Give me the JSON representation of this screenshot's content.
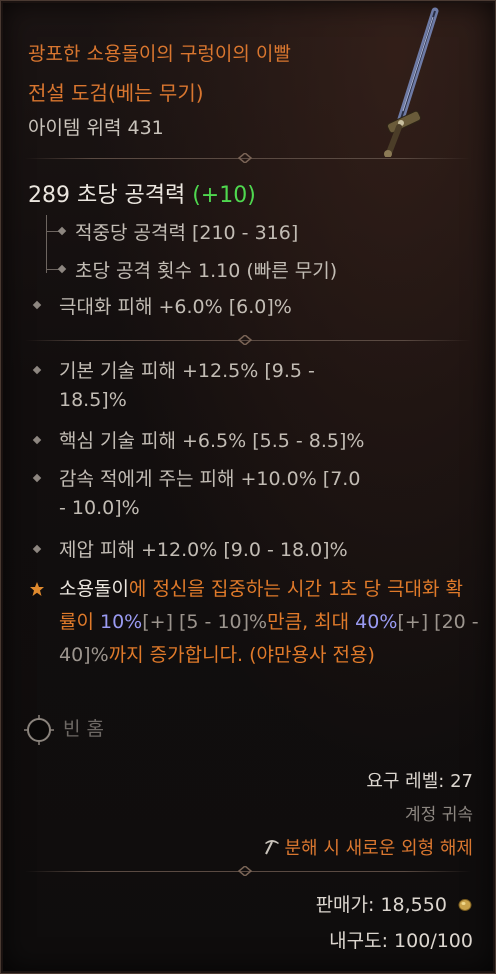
{
  "item": {
    "name": "광포한 소용돌이의 구렁이의 이빨",
    "type": "전설 도검(베는 무기)",
    "power": "아이템 위력 431"
  },
  "damage": {
    "dps": "289 초당 공격력",
    "dps_bonus": "(+10)",
    "per_hit": "적중당 공격력 [210 - 316]",
    "attack_speed": "초당 공격 횟수 1.10 (빠른 무기)"
  },
  "implicit": "극대화 피해 +6.0% [6.0]%",
  "affixes": [
    {
      "line1": "기본 기술 피해 +12.5% [9.5 -",
      "line2": "18.5]%"
    },
    {
      "line1": "핵심 기술 피해 +6.5% [5.5 - 8.5]%",
      "line2": ""
    },
    {
      "line1": "감속 적에게 주는 피해 +10.0% [7.0",
      "line2": "- 10.0]%"
    },
    {
      "line1": "제압 피해 +12.0% [9.0 - 18.0]%",
      "line2": ""
    }
  ],
  "legendary": {
    "p1": "소용돌이",
    "p2": "에 정신을 집중하는 시간 1초 당 극대화 확률이 ",
    "p3": "10%",
    "p4": "[+] [5 - 10]%",
    "p5": "만큼, 최대 ",
    "p6": "40%",
    "p7": "[+] [20 - 40]%",
    "p8": "까지 증가합니다. (야만용사 전용)"
  },
  "socket": "빈 홈",
  "requirements": {
    "level": "요구 레벨: 27",
    "bound": "계정 귀속",
    "salvage": "분해 시 새로운 외형 해제"
  },
  "footer": {
    "sell": "판매가: 18,550",
    "durability": "내구도: 100/100"
  },
  "colors": {
    "legendary": "#d9762f",
    "bonus": "#4fd84f",
    "value_highlight": "#9a9bf2"
  }
}
